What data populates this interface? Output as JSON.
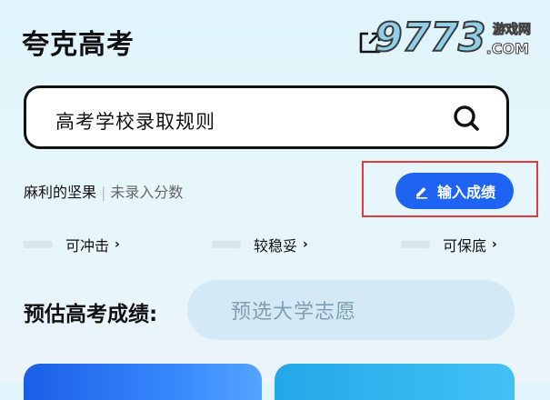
{
  "header": {
    "title": "夸克高考",
    "share_icon": "share-icon"
  },
  "watermark": {
    "number": "9773",
    "site": "游戏网",
    "domain": ".COM"
  },
  "search": {
    "query": "高考学校录取规则",
    "icon": "search-icon"
  },
  "user": {
    "name": "麻利的坚果",
    "separator": "|",
    "status": "未录入分数"
  },
  "enter_score_button": {
    "label": "输入成绩",
    "icon": "pencil-icon",
    "color": "#1f63f2"
  },
  "tiers": [
    {
      "label": "可冲击",
      "arrow": "›"
    },
    {
      "label": "较稳妥",
      "arrow": "›"
    },
    {
      "label": "可保底",
      "arrow": "›"
    }
  ],
  "estimate": {
    "label": "预估高考成绩:",
    "button_label": "预选大学志愿"
  },
  "colors": {
    "accent": "#1f63f2",
    "highlight": "#e23b3b"
  }
}
